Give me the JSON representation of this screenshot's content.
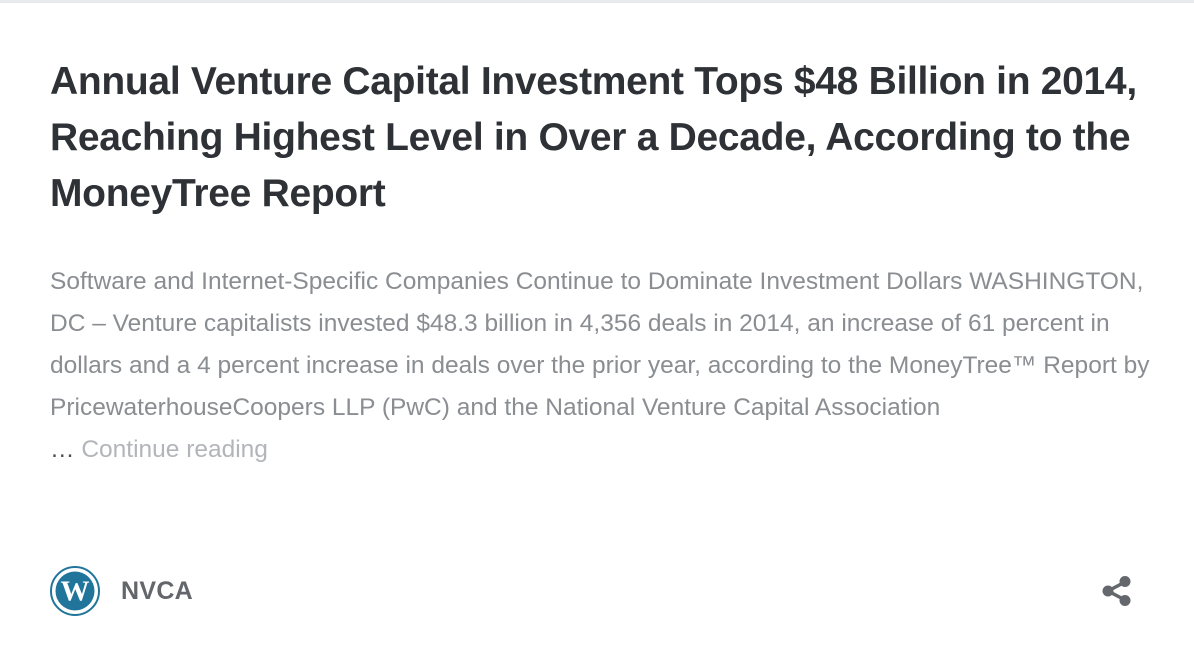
{
  "post": {
    "title": "Annual Venture Capital Investment Tops $48 Billion in 2014, Reaching Highest Level in Over a Decade, According to the MoneyTree Report",
    "excerpt": "Software and Internet-Specific Companies Continue to Dominate Investment Dollars WASHINGTON, DC – Venture capitalists invested $48.3 billion in 4,356 deals in 2014, an increase of 61 percent in dollars and a 4 percent increase in deals over the prior year, according to the MoneyTree™ Report by PricewaterhouseCoopers LLP (PwC) and the National Venture Capital Association",
    "ellipsis": "…",
    "continue_label": "Continue reading"
  },
  "footer": {
    "site_name": "NVCA",
    "avatar_icon": "wordpress-logo-icon",
    "share_icon": "share-icon"
  },
  "colors": {
    "title": "#2e3135",
    "excerpt": "#8a8d91",
    "continue_link": "#b2b5b9",
    "site_name": "#63666a",
    "wordpress_blue": "#21759b",
    "share_icon": "#64676b"
  }
}
